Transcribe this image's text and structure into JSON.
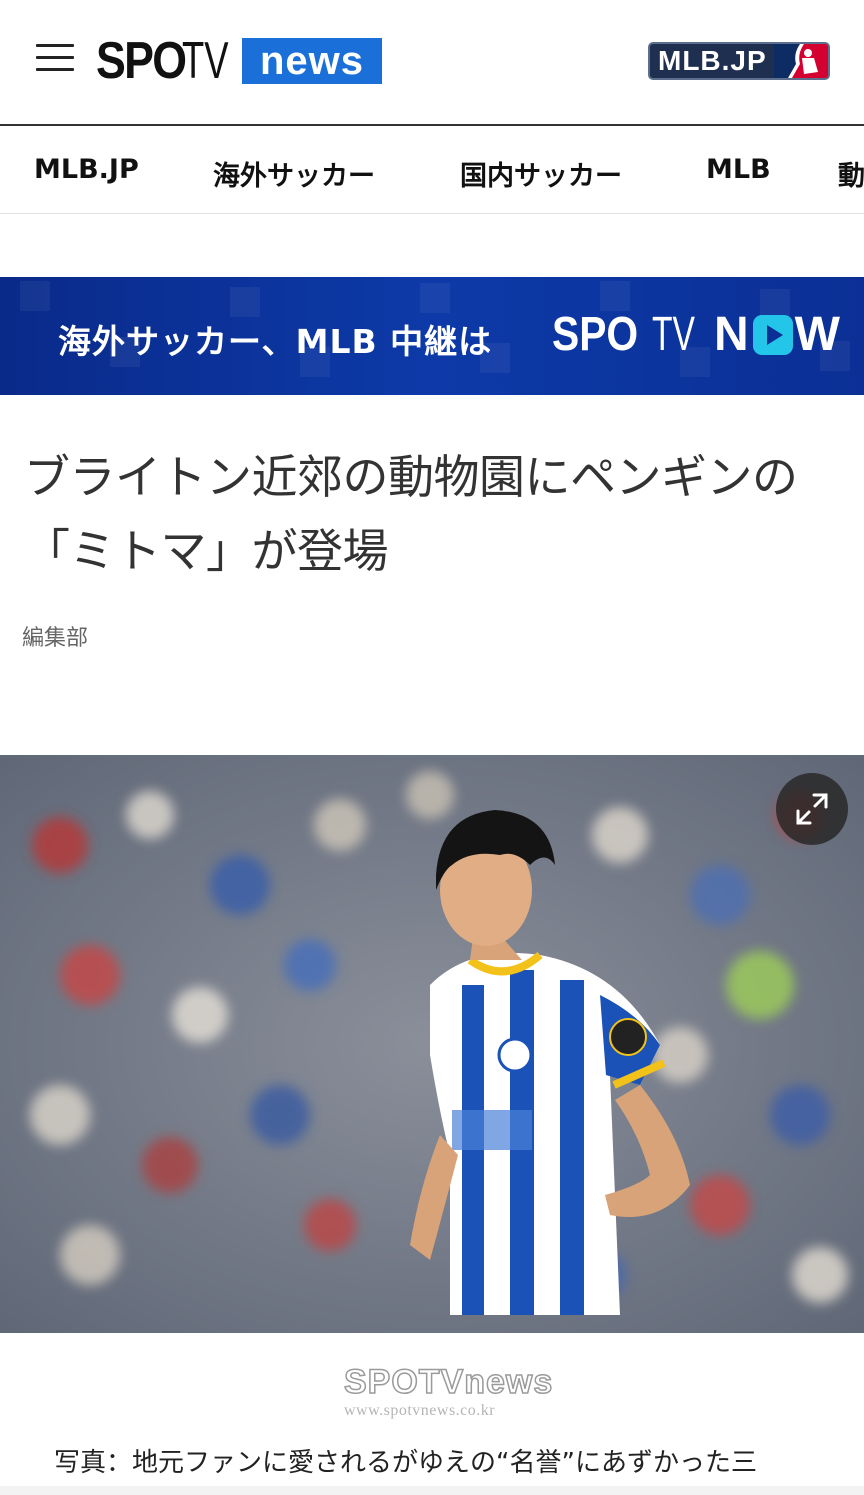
{
  "header": {
    "logo_main": "SPO",
    "logo_tv": "TV",
    "logo_news": "news",
    "mlb_badge": "MLB.JP"
  },
  "nav": {
    "items": [
      {
        "label": "MLB.JP"
      },
      {
        "label": "海外サッカー"
      },
      {
        "label": "国内サッカー"
      },
      {
        "label": "MLB"
      },
      {
        "label": "動"
      }
    ]
  },
  "banner": {
    "text": "海外サッカー、MLB 中継は",
    "logo_spo": "SPO",
    "logo_tv": "TV",
    "logo_n": "N",
    "logo_w": "W"
  },
  "article": {
    "title": "ブライトン近郊の動物園にペンギンの「ミトマ」が登場",
    "author": "編集部",
    "watermark_main": "SPOTVnews",
    "watermark_url": "www.spotvnews.co.kr",
    "caption": "写真：地元ファンに愛されるがゆえの“名誉”にあずかった三"
  },
  "colors": {
    "accent_blue": "#1b6fd9",
    "banner_blue": "#0d3aa8",
    "now_cyan": "#23c6e8",
    "mlb_navy": "#1f2f4f"
  },
  "icons": {
    "menu": "hamburger-menu-icon",
    "expand": "expand-arrows-icon"
  }
}
